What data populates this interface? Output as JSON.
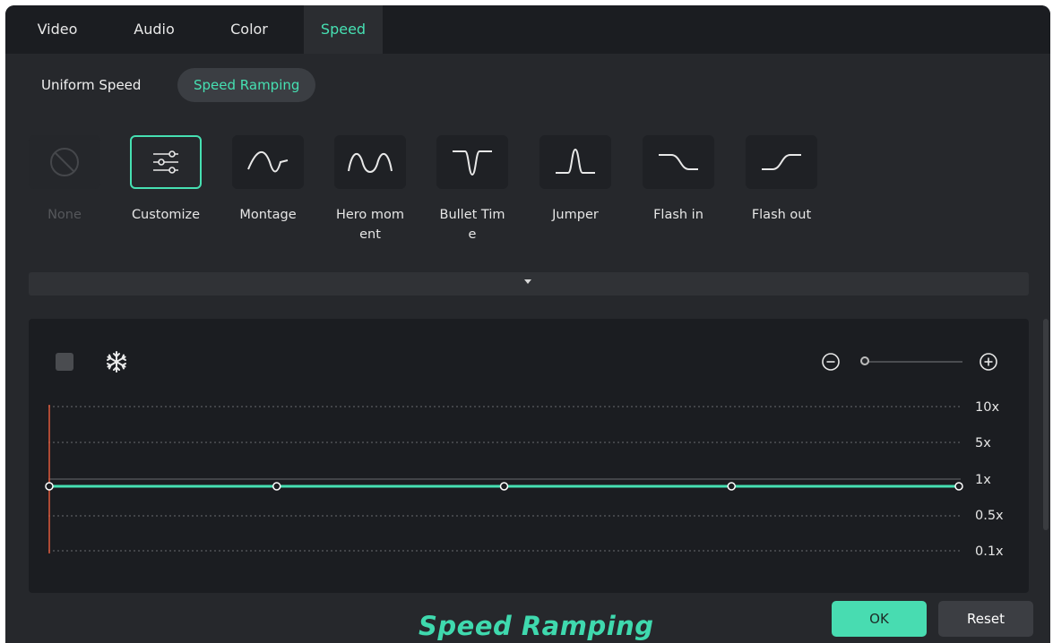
{
  "tabs": [
    {
      "label": "Video",
      "active": false
    },
    {
      "label": "Audio",
      "active": false
    },
    {
      "label": "Color",
      "active": false
    },
    {
      "label": "Speed",
      "active": true
    }
  ],
  "subtabs": [
    {
      "label": "Uniform Speed",
      "active": false
    },
    {
      "label": "Speed Ramping",
      "active": true
    }
  ],
  "presets": [
    {
      "label": "None",
      "icon": "none-icon",
      "state": "disabled"
    },
    {
      "label": "Customize",
      "icon": "customize-sliders-icon",
      "state": "selected"
    },
    {
      "label": "Montage",
      "icon": "montage-curve-icon",
      "state": "normal"
    },
    {
      "label": "Hero moment",
      "icon": "hero-moment-curve-icon",
      "state": "normal"
    },
    {
      "label": "Bullet Time",
      "icon": "bullet-time-curve-icon",
      "state": "normal"
    },
    {
      "label": "Jumper",
      "icon": "jumper-curve-icon",
      "state": "normal"
    },
    {
      "label": "Flash in",
      "icon": "flash-in-curve-icon",
      "state": "normal"
    },
    {
      "label": "Flash out",
      "icon": "flash-out-curve-icon",
      "state": "normal"
    }
  ],
  "graph": {
    "speed_levels": [
      "10x",
      "5x",
      "1x",
      "0.5x",
      "0.1x"
    ],
    "current_speed": "1x",
    "keyframe_count": 5,
    "zoom_level": 0.03
  },
  "footer": {
    "title": "Speed Ramping",
    "ok_label": "OK",
    "reset_label": "Reset"
  },
  "colors": {
    "accent": "#46e0b2",
    "background": "#26282c",
    "panel": "#1b1d21",
    "playhead": "#e05a3a"
  }
}
